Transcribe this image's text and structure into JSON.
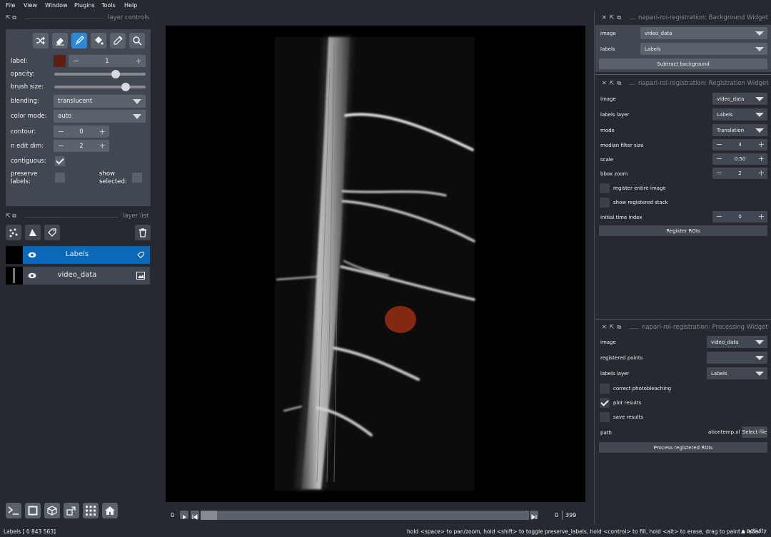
{
  "menu": [
    "File",
    "View",
    "Window",
    "Plugins",
    "Tools",
    "Help"
  ],
  "layer_controls": {
    "title": "layer controls",
    "label_label": "label:",
    "label_value": "1",
    "label_color": "#5c1f12",
    "opacity_label": "opacity:",
    "opacity_value": 0.82,
    "brush_label": "brush size:",
    "brush_value": 0.78,
    "blending_label": "blending:",
    "blending_value": "translucent",
    "colormode_label": "color mode:",
    "colormode_value": "auto",
    "contour_label": "contour:",
    "contour_value": "0",
    "nedit_label": "n edit dim:",
    "nedit_value": "2",
    "contiguous_label": "contiguous:",
    "preserve_label": "preserve labels:",
    "show_selected_label": "show selected:"
  },
  "layer_list": {
    "title": "layer list",
    "layers": [
      {
        "name": "Labels",
        "selected": true,
        "icon": "tag-icon"
      },
      {
        "name": "video_data",
        "selected": false,
        "icon": "image-icon"
      }
    ]
  },
  "dims": {
    "start": "0",
    "current": "0",
    "max": "399",
    "position": 0.0
  },
  "bg_widget": {
    "title": "napari-roi-registration: Background Widget",
    "image_label": "image",
    "image_value": "video_data",
    "labels_label": "labels",
    "labels_value": "Labels",
    "button": "Subtract background"
  },
  "reg_widget": {
    "title": "napari-roi-registration: Registration Widget",
    "image_label": "image",
    "image_value": "video_data",
    "labels_layer_label": "labels layer",
    "labels_layer_value": "Labels",
    "mode_label": "mode",
    "mode_value": "Translation",
    "median_label": "median filter size",
    "median_value": "3",
    "scale_label": "scale",
    "scale_value": "0.50",
    "bbox_label": "bbox zoom",
    "bbox_value": "2",
    "register_entire": "register entire image",
    "show_registered": "show registered stack",
    "initial_time_label": "initial time index",
    "initial_time_value": "0",
    "button": "Register ROIs"
  },
  "proc_widget": {
    "title": "napari-roi-registration: Processing Widget",
    "image_label": "image",
    "image_value": "video_data",
    "points_label": "registered points",
    "points_value": "",
    "labels_layer_label": "labels layer",
    "labels_layer_value": "Labels",
    "photobleach": "correct photobleaching",
    "plot_results": "plot results",
    "save_results": "save results",
    "path_label": "path",
    "path_value": "ationtemp.xls",
    "select_file": "Select file",
    "button": "Process registered ROIs"
  },
  "status": {
    "left": "Labels [  0 843 563]",
    "right": "hold <space> to pan/zoom, hold <shift> to toggle preserve_labels, hold <control> to fill, hold <alt> to erase, drag to paint a label",
    "activity": "activity"
  },
  "colors": {
    "accent": "#2d8ad6",
    "selected_layer": "#0b67b7",
    "label_blob": "#8b2a12"
  }
}
